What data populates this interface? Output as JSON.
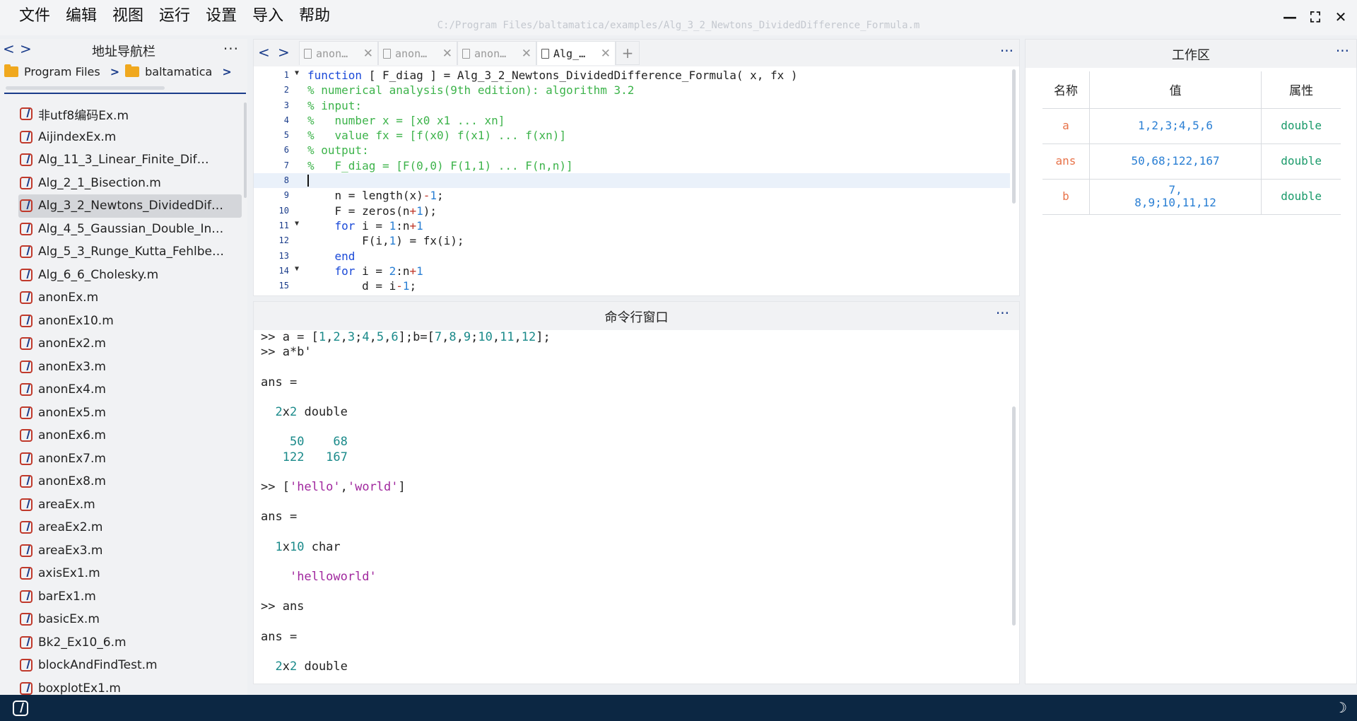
{
  "menu": [
    "文件",
    "编辑",
    "视图",
    "运行",
    "设置",
    "导入",
    "帮助"
  ],
  "window_path": "C:/Program Files/baltamatica/examples/Alg_3_2_Newtons_DividedDifference_Formula.m",
  "window_controls": {
    "minimize": "—",
    "maximize": "⛶",
    "close": "✕"
  },
  "left_panel": {
    "title": "地址导航栏",
    "back": "<",
    "forward": ">",
    "more": "···",
    "breadcrumb": [
      "Program Files",
      "baltamatica"
    ],
    "breadcrumb_sep": ">",
    "files": [
      "非utf8编码Ex.m",
      "AijindexEx.m",
      "Alg_11_3_Linear_Finite_Dif…",
      "Alg_2_1_Bisection.m",
      "Alg_3_2_Newtons_DividedDif…",
      "Alg_4_5_Gaussian_Double_In…",
      "Alg_5_3_Runge_Kutta_Fehlbe…",
      "Alg_6_6_Cholesky.m",
      "anonEx.m",
      "anonEx10.m",
      "anonEx2.m",
      "anonEx3.m",
      "anonEx4.m",
      "anonEx5.m",
      "anonEx6.m",
      "anonEx7.m",
      "anonEx8.m",
      "areaEx.m",
      "areaEx2.m",
      "areaEx3.m",
      "axisEx1.m",
      "barEx1.m",
      "basicEx.m",
      "Bk2_Ex10_6.m",
      "blockAndFindTest.m",
      "boxplotEx1.m"
    ],
    "selected_index": 4
  },
  "editor": {
    "back": "<",
    "forward": ">",
    "more": "···",
    "add_tab": "+",
    "tab_close": "✕",
    "tabs": [
      {
        "label": "anon…",
        "active": false
      },
      {
        "label": "anon…",
        "active": false
      },
      {
        "label": "anon…",
        "active": false
      },
      {
        "label": "Alg_…",
        "active": true
      }
    ],
    "current_line": 8,
    "lines": [
      {
        "n": "1",
        "fold": true,
        "tokens": [
          [
            "kw",
            "function"
          ],
          [
            "default",
            " [ F_diag ] = Alg_3_2_Newtons_DividedDifference_Formula( x, fx )"
          ]
        ]
      },
      {
        "n": "2",
        "tokens": [
          [
            "comment",
            "% numerical analysis(9th edition): algorithm 3.2"
          ]
        ]
      },
      {
        "n": "3",
        "tokens": [
          [
            "comment",
            "% input:"
          ]
        ]
      },
      {
        "n": "4",
        "tokens": [
          [
            "comment",
            "%   number x = [x0 x1 ... xn]"
          ]
        ]
      },
      {
        "n": "5",
        "tokens": [
          [
            "comment",
            "%   value fx = [f(x0) f(x1) ... f(xn)]"
          ]
        ]
      },
      {
        "n": "6",
        "tokens": [
          [
            "comment",
            "% output:"
          ]
        ]
      },
      {
        "n": "7",
        "tokens": [
          [
            "comment",
            "%   F_diag = [F(0,0) F(1,1) ... F(n,n)]"
          ]
        ]
      },
      {
        "n": "8",
        "tokens": []
      },
      {
        "n": "9",
        "tokens": [
          [
            "default",
            "    n = length(x)"
          ],
          [
            "op",
            "-"
          ],
          [
            "num",
            "1"
          ],
          [
            "default",
            ";"
          ]
        ]
      },
      {
        "n": "10",
        "tokens": [
          [
            "default",
            "    F = zeros(n"
          ],
          [
            "op",
            "+"
          ],
          [
            "num",
            "1"
          ],
          [
            "default",
            ");"
          ]
        ]
      },
      {
        "n": "11",
        "fold": true,
        "tokens": [
          [
            "default",
            "    "
          ],
          [
            "kw",
            "for"
          ],
          [
            "default",
            " i = "
          ],
          [
            "num",
            "1"
          ],
          [
            "default",
            ":n"
          ],
          [
            "op",
            "+"
          ],
          [
            "num",
            "1"
          ]
        ]
      },
      {
        "n": "12",
        "tokens": [
          [
            "default",
            "        F(i,"
          ],
          [
            "num",
            "1"
          ],
          [
            "default",
            ") = fx(i);"
          ]
        ]
      },
      {
        "n": "13",
        "tokens": [
          [
            "default",
            "    "
          ],
          [
            "kw",
            "end"
          ]
        ]
      },
      {
        "n": "14",
        "fold": true,
        "tokens": [
          [
            "default",
            "    "
          ],
          [
            "kw",
            "for"
          ],
          [
            "default",
            " i = "
          ],
          [
            "num",
            "2"
          ],
          [
            "default",
            ":n"
          ],
          [
            "op",
            "+"
          ],
          [
            "num",
            "1"
          ]
        ]
      },
      {
        "n": "15",
        "tokens": [
          [
            "default",
            "        d = i"
          ],
          [
            "op",
            "-"
          ],
          [
            "num",
            "1"
          ],
          [
            "default",
            ";"
          ]
        ]
      }
    ]
  },
  "command_window": {
    "title": "命令行窗口",
    "more": "···",
    "lines": [
      [
        [
          "p",
          ">> a = ["
        ],
        [
          "n",
          "1"
        ],
        [
          "p",
          ","
        ],
        [
          "n",
          "2"
        ],
        [
          "p",
          ","
        ],
        [
          "n",
          "3"
        ],
        [
          "p",
          ";"
        ],
        [
          "n",
          "4"
        ],
        [
          "p",
          ","
        ],
        [
          "n",
          "5"
        ],
        [
          "p",
          ","
        ],
        [
          "n",
          "6"
        ],
        [
          "p",
          "];b=["
        ],
        [
          "n",
          "7"
        ],
        [
          "p",
          ","
        ],
        [
          "n",
          "8"
        ],
        [
          "p",
          ","
        ],
        [
          "n",
          "9"
        ],
        [
          "p",
          ";"
        ],
        [
          "n",
          "10"
        ],
        [
          "p",
          ","
        ],
        [
          "n",
          "11"
        ],
        [
          "p",
          ","
        ],
        [
          "n",
          "12"
        ],
        [
          "p",
          "];"
        ]
      ],
      [
        [
          "p",
          ">> a*b'"
        ]
      ],
      [],
      [
        [
          "p",
          "ans ="
        ]
      ],
      [],
      [
        [
          "p",
          "  "
        ],
        [
          "n",
          "2"
        ],
        [
          "p",
          "x"
        ],
        [
          "n",
          "2"
        ],
        [
          "p",
          " double"
        ]
      ],
      [],
      [
        [
          "p",
          "    "
        ],
        [
          "n",
          "50"
        ],
        [
          "p",
          "    "
        ],
        [
          "n",
          "68"
        ]
      ],
      [
        [
          "p",
          "   "
        ],
        [
          "n",
          "122"
        ],
        [
          "p",
          "   "
        ],
        [
          "n",
          "167"
        ]
      ],
      [],
      [
        [
          "p",
          ">> ["
        ],
        [
          "s",
          "'hello'"
        ],
        [
          "p",
          ","
        ],
        [
          "s",
          "'world'"
        ],
        [
          "p",
          "]"
        ]
      ],
      [],
      [
        [
          "p",
          "ans ="
        ]
      ],
      [],
      [
        [
          "p",
          "  "
        ],
        [
          "n",
          "1"
        ],
        [
          "p",
          "x"
        ],
        [
          "n",
          "10"
        ],
        [
          "p",
          " char"
        ]
      ],
      [],
      [
        [
          "p",
          "    "
        ],
        [
          "s",
          "'helloworld'"
        ]
      ],
      [],
      [
        [
          "p",
          ">> ans"
        ]
      ],
      [],
      [
        [
          "p",
          "ans ="
        ]
      ],
      [],
      [
        [
          "p",
          "  "
        ],
        [
          "n",
          "2"
        ],
        [
          "p",
          "x"
        ],
        [
          "n",
          "2"
        ],
        [
          "p",
          " double"
        ]
      ]
    ]
  },
  "workspace": {
    "title": "工作区",
    "more": "···",
    "columns": [
      "名称",
      "值",
      "属性"
    ],
    "rows": [
      {
        "name": "a",
        "value": "1,2,3;4,5,6",
        "type": "double"
      },
      {
        "name": "ans",
        "value": "50,68;122,167",
        "type": "double"
      },
      {
        "name": "b",
        "value": "7,\n8,9;10,11,12",
        "type": "double"
      }
    ]
  },
  "statusbar": {
    "theme_icon": "☽"
  }
}
